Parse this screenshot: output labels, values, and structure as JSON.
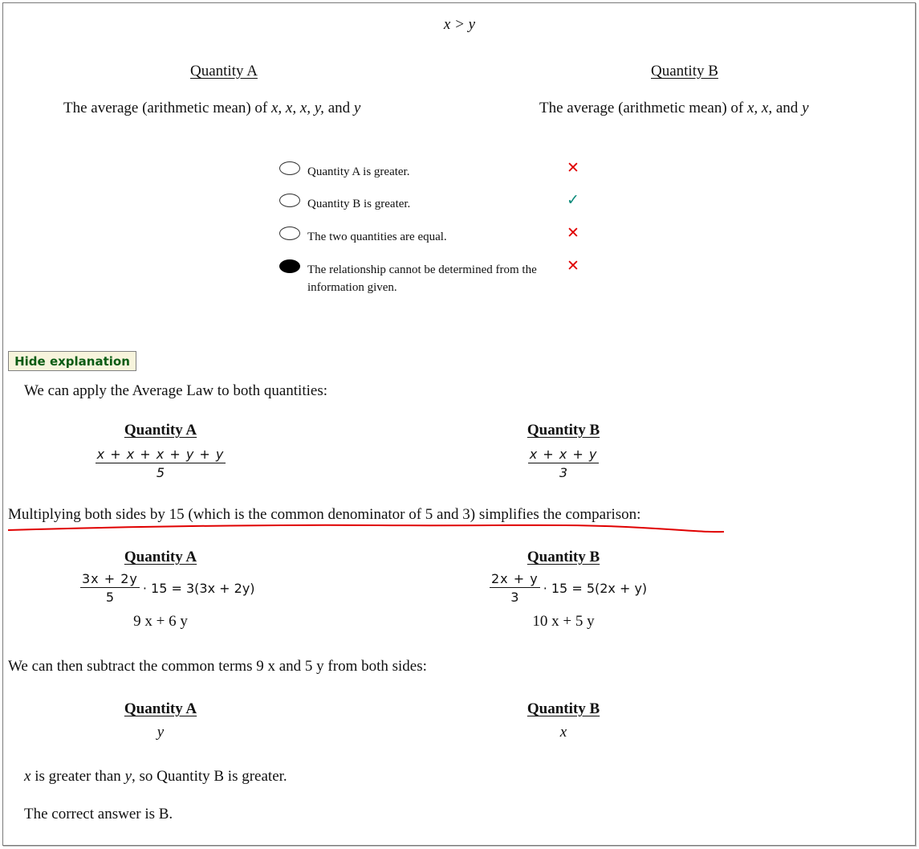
{
  "question": {
    "stem": "x > y",
    "quantity_a": {
      "heading": "Quantity A",
      "prefix": "The average (arithmetic mean) of ",
      "vars": "x, x, x, y,",
      "and": " and ",
      "last": "y"
    },
    "quantity_b": {
      "heading": "Quantity B",
      "prefix": "The average (arithmetic mean) of ",
      "vars": "x, x,",
      "and": " and ",
      "last": "y"
    }
  },
  "choices": [
    {
      "label": "Quantity A is greater.",
      "selected": false,
      "mark": "✕",
      "mark_type": "cross"
    },
    {
      "label": "Quantity B is greater.",
      "selected": false,
      "mark": "✓",
      "mark_type": "check"
    },
    {
      "label": "The two quantities are equal.",
      "selected": false,
      "mark": "✕",
      "mark_type": "cross"
    },
    {
      "label": "The relationship cannot be determined from the information given.",
      "selected": true,
      "mark": "✕",
      "mark_type": "cross"
    }
  ],
  "hide_button": "Hide explanation",
  "explanation": {
    "intro": "We can apply the Average Law to both quantities:",
    "step1": {
      "a_heading": "Quantity A",
      "a_num": "x + x + x + y + y",
      "a_den": "5",
      "b_heading": "Quantity B",
      "b_num": "x + x + y",
      "b_den": "3"
    },
    "multiply_text": "Multiplying both sides by 15 (which is the common denominator of 5 and 3) simplifies the comparison:",
    "step2": {
      "a_heading": "Quantity A",
      "a_num": "3x + 2y",
      "a_den": "5",
      "a_rhs": "· 15 = 3(3x + 2y)",
      "a_result": "9 x + 6 y",
      "b_heading": "Quantity B",
      "b_num": "2x + y",
      "b_den": "3",
      "b_rhs": "· 15 = 5(2x + y)",
      "b_result": "10 x + 5 y"
    },
    "subtract_text": "We can then subtract the common terms 9 x and 5 y from both sides:",
    "step3": {
      "a_heading": "Quantity A",
      "a_value": "y",
      "b_heading": "Quantity B",
      "b_value": "x"
    },
    "conclusion": {
      "x": "x",
      "text1": " is greater than ",
      "y": "y",
      "text2": ", so Quantity B is greater."
    },
    "answer": "The correct answer is B."
  },
  "colors": {
    "annotation_line": "#e00000",
    "check": "#0a8a7a",
    "cross": "#e00000"
  }
}
